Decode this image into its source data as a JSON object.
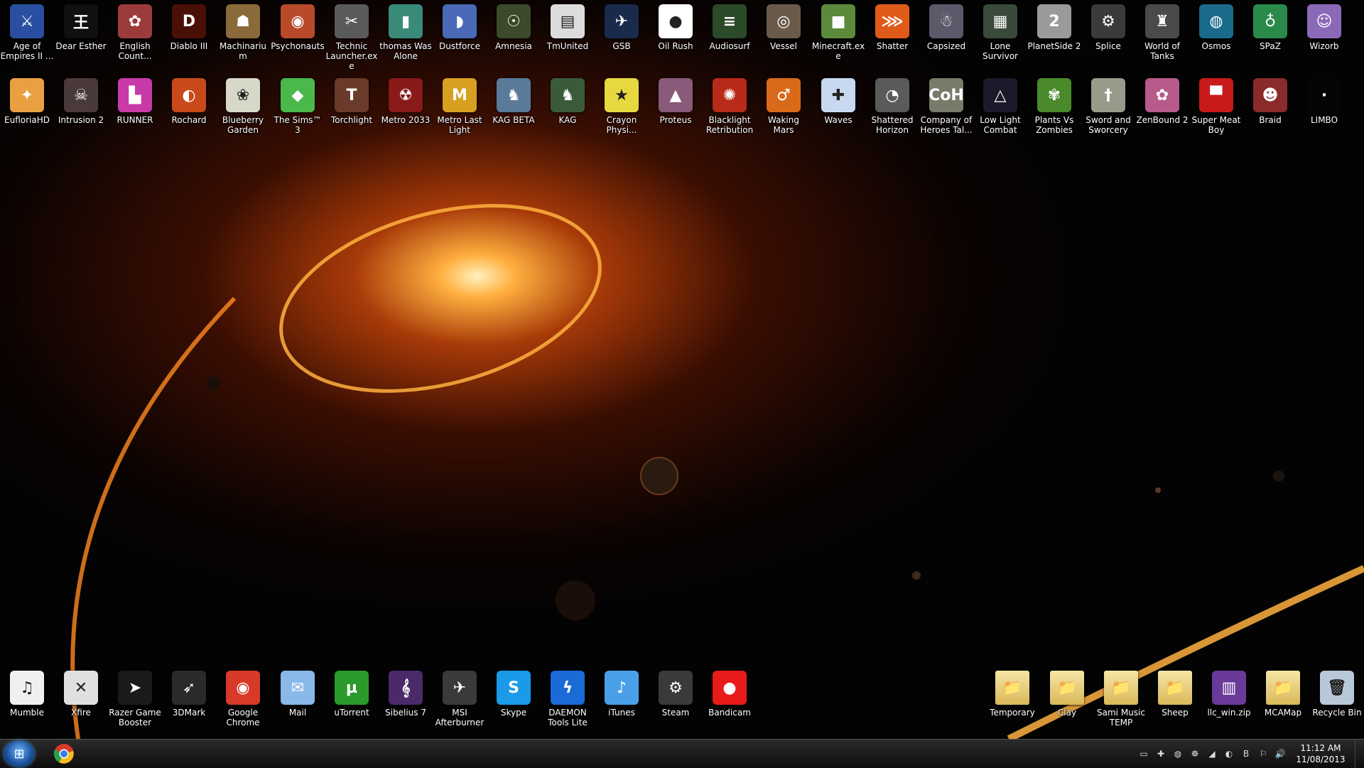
{
  "desktop": {
    "row1": [
      {
        "label": "Age of Empires II ...",
        "name": "age-of-empires-icon",
        "glyph": "⚔",
        "color": "#2a4fa0"
      },
      {
        "label": "Dear Esther",
        "name": "dear-esther-icon",
        "glyph": "王",
        "color": "#101010"
      },
      {
        "label": "English Count...",
        "name": "english-country-icon",
        "glyph": "✿",
        "color": "#9c3b3b"
      },
      {
        "label": "Diablo III",
        "name": "diablo-iii-icon",
        "glyph": "D",
        "color": "#4a1008"
      },
      {
        "label": "Machinarium",
        "name": "machinarium-icon",
        "glyph": "☗",
        "color": "#8a6a3a"
      },
      {
        "label": "Psychonauts",
        "name": "psychonauts-icon",
        "glyph": "◉",
        "color": "#b84a2a"
      },
      {
        "label": "Technic Launcher.exe",
        "name": "technic-launcher-icon",
        "glyph": "✂",
        "color": "#5a5a5a"
      },
      {
        "label": "thomas Was Alone",
        "name": "thomas-was-alone-icon",
        "glyph": "▮",
        "color": "#3a8a7a"
      },
      {
        "label": "Dustforce",
        "name": "dustforce-icon",
        "glyph": "◗",
        "color": "#4a6ab8"
      },
      {
        "label": "Amnesia",
        "name": "amnesia-icon",
        "glyph": "☉",
        "color": "#3a4a2a"
      },
      {
        "label": "TmUnited",
        "name": "tmunited-icon",
        "glyph": "▤",
        "color": "#dcdcdc"
      },
      {
        "label": "GSB",
        "name": "gsb-icon",
        "glyph": "✈",
        "color": "#1a2a4a"
      },
      {
        "label": "Oil Rush",
        "name": "oil-rush-icon",
        "glyph": "●",
        "color": "#ffffff"
      },
      {
        "label": "Audiosurf",
        "name": "audiosurf-icon",
        "glyph": "≡",
        "color": "#2a4a2a"
      },
      {
        "label": "Vessel",
        "name": "vessel-icon",
        "glyph": "◎",
        "color": "#6a5a4a"
      },
      {
        "label": "Minecraft.exe",
        "name": "minecraft-icon",
        "glyph": "■",
        "color": "#5a8a3a"
      },
      {
        "label": "Shatter",
        "name": "shatter-icon",
        "glyph": "⋙",
        "color": "#e05a1a"
      },
      {
        "label": "Capsized",
        "name": "capsized-icon",
        "glyph": "☃",
        "color": "#5a5a6a"
      },
      {
        "label": "Lone Survivor",
        "name": "lone-survivor-icon",
        "glyph": "▦",
        "color": "#3a4a3a"
      },
      {
        "label": "PlanetSide 2",
        "name": "planetside-2-icon",
        "glyph": "2",
        "color": "#9a9a9a"
      },
      {
        "label": "Splice",
        "name": "splice-icon",
        "glyph": "⚙",
        "color": "#3a3a3a"
      },
      {
        "label": "World of Tanks",
        "name": "world-of-tanks-icon",
        "glyph": "♜",
        "color": "#4a4a4a"
      },
      {
        "label": "Osmos",
        "name": "osmos-icon",
        "glyph": "◍",
        "color": "#1a6a8a"
      },
      {
        "label": "SPaZ",
        "name": "spaz-icon",
        "glyph": "♁",
        "color": "#2a8a4a"
      },
      {
        "label": "Wizorb",
        "name": "wizorb-icon",
        "glyph": "☺",
        "color": "#8a6ab8"
      }
    ],
    "row2": [
      {
        "label": "EufloriaHD",
        "name": "eufloria-hd-icon",
        "glyph": "✦",
        "color": "#e8a040"
      },
      {
        "label": "Intrusion 2",
        "name": "intrusion-2-icon",
        "glyph": "☠",
        "color": "#4a3a3a"
      },
      {
        "label": "RUNNER",
        "name": "runner-icon",
        "glyph": "▙",
        "color": "#c83aa8"
      },
      {
        "label": "Rochard",
        "name": "rochard-icon",
        "glyph": "◐",
        "color": "#c84a1a"
      },
      {
        "label": "Blueberry Garden",
        "name": "blueberry-garden-icon",
        "glyph": "❀",
        "color": "#d8d8c8"
      },
      {
        "label": "The Sims™ 3",
        "name": "the-sims-3-icon",
        "glyph": "◆",
        "color": "#4ab84a"
      },
      {
        "label": "Torchlight",
        "name": "torchlight-icon",
        "glyph": "T",
        "color": "#6a3a2a"
      },
      {
        "label": "Metro 2033",
        "name": "metro-2033-icon",
        "glyph": "☢",
        "color": "#8a1a1a"
      },
      {
        "label": "Metro Last Light",
        "name": "metro-last-light-icon",
        "glyph": "M",
        "color": "#d8a020"
      },
      {
        "label": "KAG BETA",
        "name": "kag-beta-icon",
        "glyph": "♞",
        "color": "#5a7a9a"
      },
      {
        "label": "KAG",
        "name": "kag-icon",
        "glyph": "♞",
        "color": "#3a5a3a"
      },
      {
        "label": "Crayon Physi...",
        "name": "crayon-physics-icon",
        "glyph": "★",
        "color": "#e8d840"
      },
      {
        "label": "Proteus",
        "name": "proteus-icon",
        "glyph": "▲",
        "color": "#8a5a7a"
      },
      {
        "label": "Blacklight Retribution",
        "name": "blacklight-retribution-icon",
        "glyph": "✺",
        "color": "#b82a1a"
      },
      {
        "label": "Waking Mars",
        "name": "waking-mars-icon",
        "glyph": "♂",
        "color": "#d86a1a"
      },
      {
        "label": "Waves",
        "name": "waves-icon",
        "glyph": "✚",
        "color": "#c8d8f0"
      },
      {
        "label": "Shattered Horizon",
        "name": "shattered-horizon-icon",
        "glyph": "◔",
        "color": "#5a5a5a"
      },
      {
        "label": "Company of Heroes Tal...",
        "name": "company-of-heroes-icon",
        "glyph": "CoH",
        "color": "#7a7a6a"
      },
      {
        "label": "Low Light Combat",
        "name": "low-light-combat-icon",
        "glyph": "△",
        "color": "#1a1a2a"
      },
      {
        "label": "Plants Vs Zombies",
        "name": "plants-vs-zombies-icon",
        "glyph": "✾",
        "color": "#4a8a2a"
      },
      {
        "label": "Sword and Sworcery",
        "name": "sword-and-sworcery-icon",
        "glyph": "†",
        "color": "#9a9a8a"
      },
      {
        "label": "ZenBound 2",
        "name": "zenbound-2-icon",
        "glyph": "✿",
        "color": "#b85a8a"
      },
      {
        "label": "Super Meat Boy",
        "name": "super-meat-boy-icon",
        "glyph": "▀",
        "color": "#c81a1a"
      },
      {
        "label": "Braid",
        "name": "braid-icon",
        "glyph": "☻",
        "color": "#8a2a2a"
      },
      {
        "label": "LIMBO",
        "name": "limbo-icon",
        "glyph": "·",
        "color": "#050505"
      }
    ],
    "bottom_left": [
      {
        "label": "Mumble",
        "name": "mumble-icon",
        "glyph": "♫",
        "color": "#f0f0f0"
      },
      {
        "label": "Xfire",
        "name": "xfire-icon",
        "glyph": "✕",
        "color": "#e0e0e0"
      },
      {
        "label": "Razer Game Booster",
        "name": "razer-game-booster-icon",
        "glyph": "➤",
        "color": "#1a1a1a"
      },
      {
        "label": "3DMark",
        "name": "3dmark-icon",
        "glyph": "➶",
        "color": "#2a2a2a"
      },
      {
        "label": "Google Chrome",
        "name": "google-chrome-icon",
        "glyph": "◉",
        "color": "#d83a2a"
      },
      {
        "label": "Mail",
        "name": "mail-icon",
        "glyph": "✉",
        "color": "#8ab8e8"
      },
      {
        "label": "uTorrent",
        "name": "utorrent-icon",
        "glyph": "µ",
        "color": "#2a9a2a"
      },
      {
        "label": "Sibelius 7",
        "name": "sibelius-7-icon",
        "glyph": "𝄞",
        "color": "#4a2a6a"
      },
      {
        "label": "MSI Afterburner",
        "name": "msi-afterburner-icon",
        "glyph": "✈",
        "color": "#3a3a3a"
      },
      {
        "label": "Skype",
        "name": "skype-icon",
        "glyph": "S",
        "color": "#1a9ae8"
      },
      {
        "label": "DAEMON Tools Lite",
        "name": "daemon-tools-lite-icon",
        "glyph": "ϟ",
        "color": "#1a6ad8"
      },
      {
        "label": "iTunes",
        "name": "itunes-icon",
        "glyph": "♪",
        "color": "#4aa0e8"
      },
      {
        "label": "Steam",
        "name": "steam-icon",
        "glyph": "⚙",
        "color": "#3a3a3a"
      },
      {
        "label": "Bandicam",
        "name": "bandicam-icon",
        "glyph": "●",
        "color": "#e81a1a"
      }
    ],
    "bottom_right": [
      {
        "label": "Temporary",
        "name": "temporary-folder-icon",
        "glyph": "📁",
        "color": "#e8d088",
        "folder": true
      },
      {
        "label": "Clay",
        "name": "clay-folder-icon",
        "glyph": "📁",
        "color": "#e8d088",
        "folder": true
      },
      {
        "label": "Sami Music TEMP",
        "name": "sami-music-temp-folder-icon",
        "glyph": "📁",
        "color": "#e8d088",
        "folder": true
      },
      {
        "label": "Sheep",
        "name": "sheep-folder-icon",
        "glyph": "📁",
        "color": "#e8d088",
        "folder": true
      },
      {
        "label": "llc_win.zip",
        "name": "llc-win-zip-icon",
        "glyph": "▥",
        "color": "#6a3a9a"
      },
      {
        "label": "MCAMap",
        "name": "mcamap-folder-icon",
        "glyph": "📁",
        "color": "#e8d088",
        "folder": true
      },
      {
        "label": "Recycle Bin",
        "name": "recycle-bin-icon",
        "glyph": "🗑",
        "color": "#b8c8d8"
      }
    ]
  },
  "taskbar": {
    "start_icon": "windows-orb-icon",
    "pinned": [
      {
        "name": "google-chrome-taskbar-icon"
      }
    ],
    "tray_icons": [
      "network-icon",
      "battery-icon",
      "security-icon",
      "shield-icon",
      "nvidia-icon",
      "update-icon",
      "bluetooth-icon",
      "action-center-icon",
      "volume-icon"
    ],
    "tray_glyphs": [
      "▭",
      "✚",
      "◍",
      "☸",
      "◢",
      "◐",
      "B",
      "⚐",
      "🔊"
    ],
    "clock_time": "11:12 AM",
    "clock_date": "11/08/2013"
  }
}
